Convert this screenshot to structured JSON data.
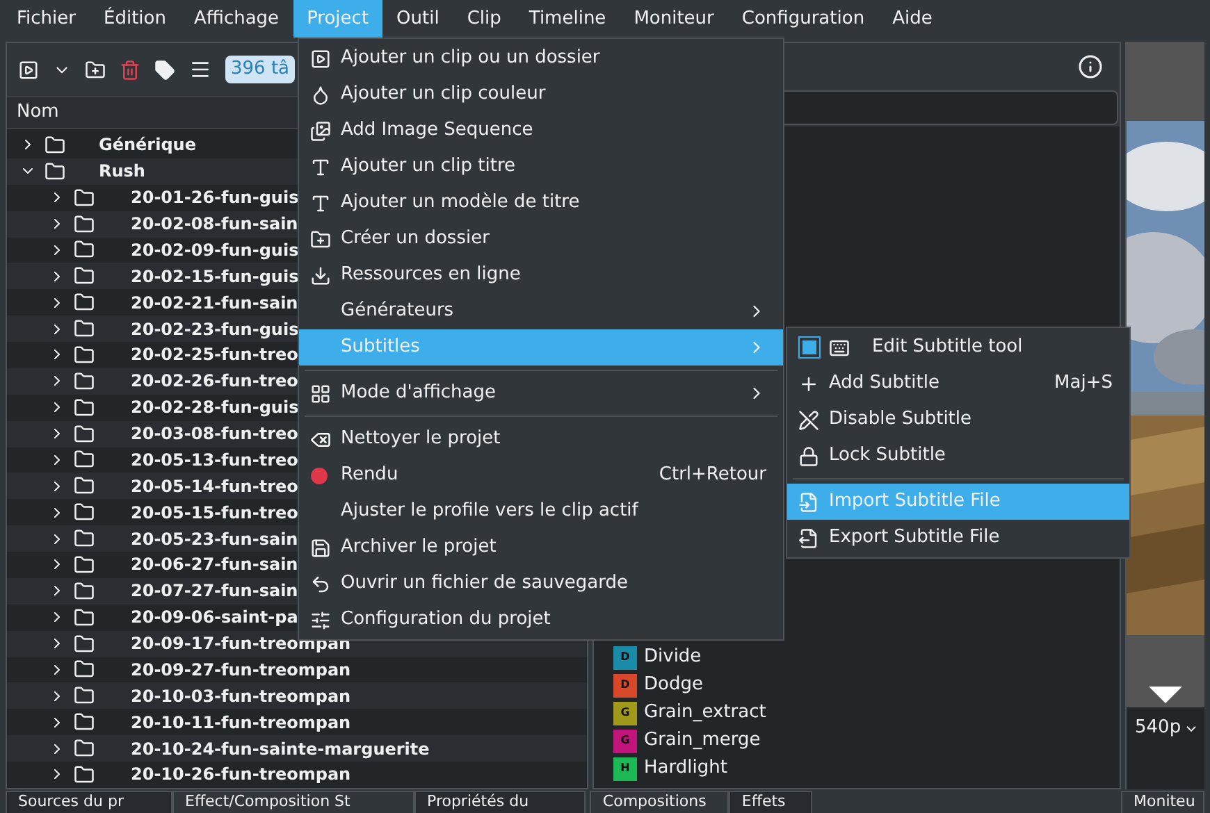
{
  "menubar": [
    {
      "label": "Fichier",
      "selected": false
    },
    {
      "label": "Édition",
      "selected": false
    },
    {
      "label": "Affichage",
      "selected": false
    },
    {
      "label": "Project",
      "selected": true
    },
    {
      "label": "Outil",
      "selected": false
    },
    {
      "label": "Clip",
      "selected": false
    },
    {
      "label": "Timeline",
      "selected": false
    },
    {
      "label": "Moniteur",
      "selected": false
    },
    {
      "label": "Configuration",
      "selected": false
    },
    {
      "label": "Aide",
      "selected": false
    }
  ],
  "bin": {
    "task_badge": "396 tâ",
    "column": "Nom",
    "tree": [
      {
        "label": "Générique",
        "expanded": false
      },
      {
        "label": "Rush",
        "expanded": true,
        "children": [
          {
            "label": "20-01-26-fun-guis"
          },
          {
            "label": "20-02-08-fun-sain"
          },
          {
            "label": "20-02-09-fun-guis"
          },
          {
            "label": "20-02-15-fun-guis"
          },
          {
            "label": "20-02-21-fun-sain"
          },
          {
            "label": "20-02-23-fun-guis"
          },
          {
            "label": "20-02-25-fun-treo"
          },
          {
            "label": "20-02-26-fun-treo"
          },
          {
            "label": "20-02-28-fun-guis"
          },
          {
            "label": "20-03-08-fun-treo"
          },
          {
            "label": "20-05-13-fun-treo"
          },
          {
            "label": "20-05-14-fun-treo"
          },
          {
            "label": "20-05-15-fun-treo"
          },
          {
            "label": "20-05-23-fun-sain"
          },
          {
            "label": "20-06-27-fun-sain"
          },
          {
            "label": "20-07-27-fun-sain"
          },
          {
            "label": "20-09-06-saint-pa"
          },
          {
            "label": "20-09-17-fun-treompan"
          },
          {
            "label": "20-09-27-fun-treompan"
          },
          {
            "label": "20-10-03-fun-treompan"
          },
          {
            "label": "20-10-11-fun-treompan"
          },
          {
            "label": "20-10-24-fun-sainte-marguerite"
          },
          {
            "label": "20-10-26-fun-treompan"
          }
        ]
      }
    ]
  },
  "effects": [
    {
      "badge": "D",
      "label": "Divide",
      "color": "#1a8ca8"
    },
    {
      "badge": "D",
      "label": "Dodge",
      "color": "#d9482b"
    },
    {
      "badge": "G",
      "label": "Grain_extract",
      "color": "#a0991c"
    },
    {
      "badge": "G",
      "label": "Grain_merge",
      "color": "#c2157c"
    },
    {
      "badge": "H",
      "label": "Hardlight",
      "color": "#1db954"
    }
  ],
  "monitor": {
    "resolution": "540p"
  },
  "bottom_tabs": [
    {
      "label": "Sources du pr",
      "selected": false
    },
    {
      "label": "Effect/Composition St",
      "selected": true
    },
    {
      "label": "Propriétés du",
      "selected": false
    },
    {
      "label": "Compositions",
      "selected": true
    },
    {
      "label": "Effets",
      "selected": false
    },
    {
      "label": "Moniteu",
      "selected": true
    }
  ],
  "project_menu": [
    {
      "kind": "item",
      "label": "Ajouter un clip ou un dossier",
      "submenu": false,
      "selected": false
    },
    {
      "kind": "item",
      "label": "Ajouter un clip couleur",
      "submenu": false,
      "selected": false
    },
    {
      "kind": "item",
      "label": "Add Image Sequence",
      "submenu": false,
      "selected": false
    },
    {
      "kind": "item",
      "label": "Ajouter un clip titre",
      "submenu": false,
      "selected": false
    },
    {
      "kind": "item",
      "label": "Ajouter un modèle de titre",
      "submenu": false,
      "selected": false
    },
    {
      "kind": "item",
      "label": "Créer un dossier",
      "submenu": false,
      "selected": false
    },
    {
      "kind": "item",
      "label": "Ressources en ligne",
      "submenu": false,
      "selected": false
    },
    {
      "kind": "item",
      "label": "Générateurs",
      "submenu": true,
      "selected": false
    },
    {
      "kind": "item",
      "label": "Subtitles",
      "submenu": true,
      "selected": true
    },
    {
      "kind": "separator"
    },
    {
      "kind": "item",
      "label": "Mode d'affichage",
      "submenu": true,
      "selected": false
    },
    {
      "kind": "separator"
    },
    {
      "kind": "item",
      "label": "Nettoyer le projet",
      "submenu": false,
      "selected": false
    },
    {
      "kind": "item",
      "label": "Rendu",
      "shortcut": "Ctrl+Retour",
      "submenu": false,
      "selected": false
    },
    {
      "kind": "item",
      "label": "Ajuster le profile vers le clip actif",
      "submenu": false,
      "selected": false
    },
    {
      "kind": "item",
      "label": "Archiver le projet",
      "submenu": false,
      "selected": false
    },
    {
      "kind": "item",
      "label": "Ouvrir un fichier de sauvegarde",
      "submenu": false,
      "selected": false
    },
    {
      "kind": "item",
      "label": "Configuration du projet",
      "submenu": false,
      "selected": false
    }
  ],
  "subtitles_menu": [
    {
      "kind": "check",
      "label": "Edit Subtitle tool",
      "checked": true,
      "selected": false
    },
    {
      "kind": "item",
      "label": "Add Subtitle",
      "shortcut": "Maj+S",
      "selected": false
    },
    {
      "kind": "item",
      "label": "Disable Subtitle",
      "selected": false
    },
    {
      "kind": "item",
      "label": "Lock Subtitle",
      "selected": false
    },
    {
      "kind": "separator"
    },
    {
      "kind": "item",
      "label": "Import Subtitle File",
      "selected": true
    },
    {
      "kind": "item",
      "label": "Export Subtitle File",
      "selected": false
    }
  ]
}
